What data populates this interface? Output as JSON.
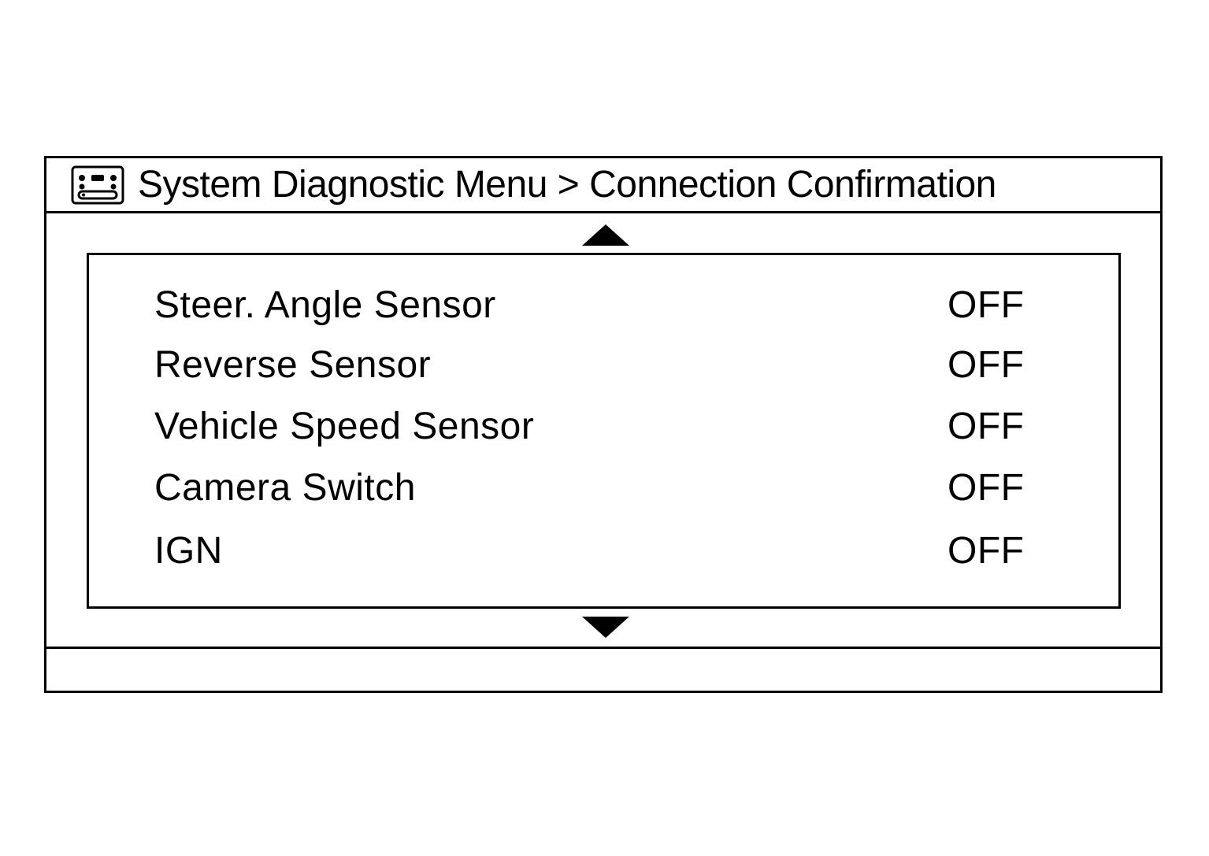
{
  "header": {
    "icon": "diagnostic-screen-icon",
    "title": "System Diagnostic Menu > Connection Confirmation"
  },
  "scroll": {
    "up_icon": "triangle-up-icon",
    "down_icon": "triangle-down-icon"
  },
  "items": [
    {
      "label": "Steer. Angle Sensor",
      "value": "OFF"
    },
    {
      "label": "Reverse Sensor",
      "value": "OFF"
    },
    {
      "label": "Vehicle Speed Sensor",
      "value": "OFF"
    },
    {
      "label": "Camera Switch",
      "value": "OFF"
    },
    {
      "label": "IGN",
      "value": "OFF"
    }
  ],
  "status_bar": {
    "text": ""
  }
}
